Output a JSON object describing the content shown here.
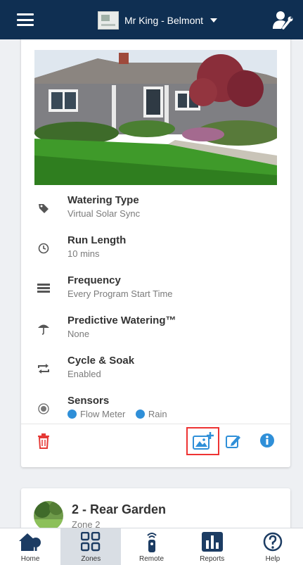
{
  "header": {
    "controller_name": "Mr King - Belmont"
  },
  "zone_card": {
    "details": [
      {
        "icon": "tag-icon",
        "title": "Watering Type",
        "value": "Virtual Solar Sync"
      },
      {
        "icon": "clock-icon",
        "title": "Run Length",
        "value": "10 mins"
      },
      {
        "icon": "calendar-icon",
        "title": "Frequency",
        "value": "Every Program Start Time"
      },
      {
        "icon": "umbrella-icon",
        "title": "Predictive Watering™",
        "value": "None"
      },
      {
        "icon": "cycle-icon",
        "title": "Cycle & Soak",
        "value": "Enabled"
      },
      {
        "icon": "sensor-icon",
        "title": "Sensors",
        "value": ""
      }
    ],
    "sensors": [
      {
        "icon": "flow-meter-icon",
        "label": "Flow Meter"
      },
      {
        "icon": "rain-icon",
        "label": "Rain"
      }
    ],
    "accent_color": "#2f8fd8",
    "delete_color": "#e53935"
  },
  "zone2": {
    "title": "2 - Rear Garden",
    "subtitle": "Zone 2"
  },
  "nav": {
    "items": [
      {
        "icon": "home-icon",
        "label": "Home",
        "active": false
      },
      {
        "icon": "zones-icon",
        "label": "Zones",
        "active": true
      },
      {
        "icon": "remote-icon",
        "label": "Remote",
        "active": false
      },
      {
        "icon": "reports-icon",
        "label": "Reports",
        "active": false
      },
      {
        "icon": "help-icon",
        "label": "Help",
        "active": false
      }
    ]
  },
  "colors": {
    "header_bg": "#0f2f52",
    "nav_icon": "#1c3c63",
    "highlight_border": "#e33333"
  }
}
